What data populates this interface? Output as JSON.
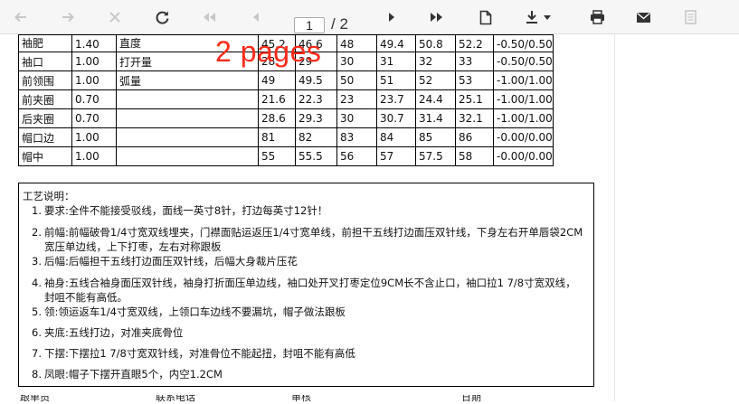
{
  "toolbar": {
    "page_current": "1",
    "page_total": "/ 2"
  },
  "overlay": {
    "text": "2 pages"
  },
  "spec_table": {
    "rows": [
      [
        "袖肥",
        "1.40",
        "直度",
        "45.2",
        "46.6",
        "48",
        "49.4",
        "50.8",
        "52.2",
        "-0.50/0.50"
      ],
      [
        "袖口",
        "1.00",
        "打开量",
        "28",
        "29",
        "30",
        "31",
        "32",
        "33",
        "-0.50/0.50"
      ],
      [
        "前领围",
        "1.00",
        "弧量",
        "49",
        "49.5",
        "50",
        "51",
        "52",
        "53",
        "-1.00/1.00"
      ],
      [
        "前夹圈",
        "0.70",
        "",
        "21.6",
        "22.3",
        "23",
        "23.7",
        "24.4",
        "25.1",
        "-1.00/1.00"
      ],
      [
        "后夹圈",
        "0.70",
        "",
        "28.6",
        "29.3",
        "30",
        "30.7",
        "31.4",
        "32.1",
        "-1.00/1.00"
      ],
      [
        "帽口边",
        "1.00",
        "",
        "81",
        "82",
        "83",
        "84",
        "85",
        "86",
        "-0.00/0.00"
      ],
      [
        "帽中",
        "1.00",
        "",
        "55",
        "55.5",
        "56",
        "57",
        "57.5",
        "58",
        "-0.00/0.00"
      ]
    ]
  },
  "notes": {
    "title": "工艺说明：",
    "items": [
      {
        "num": "1.",
        "text": "要求:全件不能接受驳线，面线一英寸8针，打边每英寸12针！"
      },
      {
        "num": "2.",
        "text": "前幅:前幅破骨1/4寸宽双线埋夹，门襟面贴运返压1/4寸宽单线，前担干五线打边面压双针线，下身左右开单唇袋2CM宽压单边线，上下打枣，左右对称跟板"
      },
      {
        "num": "3.",
        "text": "后幅:后幅担干五线打边面压双针线，后幅大身裁片压花"
      },
      {
        "num": "4.",
        "text": "袖身:五线合袖身面压双针线，袖身打折面压单边线，袖口处开叉打枣定位9CM长不含止口，袖口拉1 7/8寸宽双线，封咀不能有高低。"
      },
      {
        "num": "5.",
        "text": "领:领运返车1/4寸宽双线，上领口车边线不要漏坑，帽子做法跟板"
      },
      {
        "num": "6.",
        "text": "夹底:五线打边，对准夹底骨位"
      },
      {
        "num": "7.",
        "text": "下摆:下摆拉1 7/8寸宽双针线，对准骨位不能起扭，封咀不能有高低"
      },
      {
        "num": "8.",
        "text": "凤眼:帽子下摆开直眼5个，内空1.2CM"
      }
    ]
  },
  "footer": {
    "cells": [
      "跟单员",
      "联系电话",
      "审核",
      "日期"
    ]
  },
  "icons": {
    "first": "first-page-icon",
    "back": "back-arrow-icon",
    "forward": "forward-arrow-icon",
    "close": "close-icon",
    "reload": "reload-icon",
    "prev_fast": "prev-fast-icon",
    "prev": "prev-page-icon",
    "next": "next-page-icon",
    "next_fast": "next-fast-icon",
    "document": "document-icon",
    "download": "download-icon",
    "print": "print-icon",
    "mail": "mail-icon",
    "notes": "notes-icon"
  },
  "colors": {
    "overlay": "#ff2a1a",
    "toolbar_bg": "#f6f6f6",
    "icon_active": "#333333",
    "icon_disabled": "#c8c8c8"
  }
}
